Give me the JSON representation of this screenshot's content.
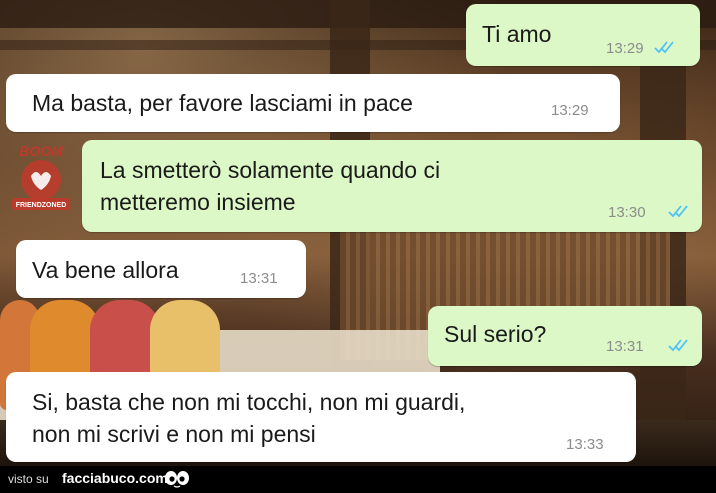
{
  "messages": [
    {
      "direction": "outgoing",
      "text": "Ti amo",
      "time": "13:29",
      "read_receipt": "double-check-read"
    },
    {
      "direction": "incoming",
      "text": "Ma basta, per favore lasciami in pace",
      "time": "13:29"
    },
    {
      "direction": "outgoing",
      "text": "La smetterò solamente quando ci\nmetteremo insieme",
      "time": "13:30",
      "read_receipt": "double-check-read"
    },
    {
      "direction": "incoming",
      "text": "Va bene allora",
      "time": "13:31"
    },
    {
      "direction": "outgoing",
      "text": "Sul serio?",
      "time": "13:31",
      "read_receipt": "double-check-read"
    },
    {
      "direction": "incoming",
      "text": "Si, basta che non mi tocchi, non mi guardi,\nnon mi scrivi e non mi pensi",
      "time": "13:33"
    }
  ],
  "logo": {
    "top_text": "BOOM",
    "bottom_text": "FRIENDZONED",
    "color": "#c0392b"
  },
  "footer": {
    "visto_label": "visto su",
    "site_name": "facciabuco.com",
    "icon": "eyes-icon"
  },
  "colors": {
    "incoming_bubble": "#ffffff",
    "outgoing_bubble": "#dcf8c6",
    "read_tick": "#4fc3f7"
  }
}
